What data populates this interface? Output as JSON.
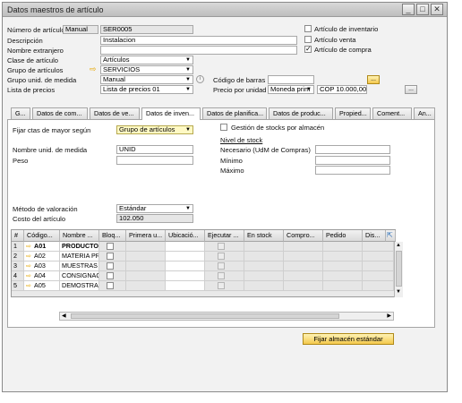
{
  "window": {
    "title": "Datos maestros de artículo"
  },
  "header": {
    "numero_label": "Número de artículo",
    "numero_mode": "Manual",
    "numero_value": "SER0005",
    "descripcion_label": "Descripción",
    "descripcion_value": "Instalacion",
    "nombre_ext_label": "Nombre extranjero",
    "clase_label": "Clase de artículo",
    "clase_value": "Artículos",
    "grupo_label": "Grupo de artículos",
    "grupo_value": "SERVICIOS",
    "grupo_unid_label": "Grupo unid. de medida",
    "grupo_unid_value": "Manual",
    "lista_label": "Lista de precios",
    "lista_value": "Lista de precios 01",
    "codigo_barras_label": "Código de barras",
    "precio_label": "Precio por unidad",
    "precio_moneda": "Moneda prim",
    "precio_value": "COP 10.000,00",
    "chk_inventario": "Artículo de inventario",
    "chk_venta": "Artículo venta",
    "chk_compra": "Artículo de compra",
    "chk_inventario_checked": false,
    "chk_venta_checked": false,
    "chk_compra_checked": true,
    "ellipsis": "...",
    "ellipsis2": "..."
  },
  "tabs": [
    "G...",
    "Datos de com...",
    "Datos de ve...",
    "Datos de inven...",
    "Datos de planifica...",
    "Datos de produc...",
    "Propied...",
    "Coment...",
    "An..."
  ],
  "inventory": {
    "fijar_label": "Fijar ctas de mayor según",
    "fijar_value": "Grupo de artículos",
    "gestion_label": "Gestión de stocks por almacén",
    "nombre_unid_label": "Nombre unid. de medida",
    "nombre_unid_value": "UNID",
    "peso_label": "Peso",
    "nivel_stock_label": "Nivel de stock",
    "necesario_label": "Necesario (UdM de Compras)",
    "minimo_label": "Mínimo",
    "maximo_label": "Máximo",
    "metodo_label": "Método de valoración",
    "metodo_value": "Estándar",
    "costo_label": "Costo del artículo",
    "costo_value": "102.050",
    "fijar_btn": "Fijar almacén estándar"
  },
  "grid": {
    "columns": [
      "#",
      "Código...",
      "Nombre ...",
      "Bloq...",
      "Primera u...",
      "Ubicació...",
      "Ejecutar ...",
      "En stock",
      "Compro...",
      "Pedido",
      "Dis..."
    ],
    "rows": [
      {
        "num": "1",
        "code": "A01",
        "name": "PRODUCTO",
        "bold": true
      },
      {
        "num": "2",
        "code": "A02",
        "name": "MATERIA PR",
        "bold": false
      },
      {
        "num": "3",
        "code": "A03",
        "name": "MUESTRAS",
        "bold": false
      },
      {
        "num": "4",
        "code": "A04",
        "name": "CONSIGNAC",
        "bold": false
      },
      {
        "num": "5",
        "code": "A05",
        "name": "DEMOSTRAC",
        "bold": false
      }
    ]
  },
  "colors": {
    "accent": "#f4c84c",
    "arrow": "#e6a800"
  }
}
